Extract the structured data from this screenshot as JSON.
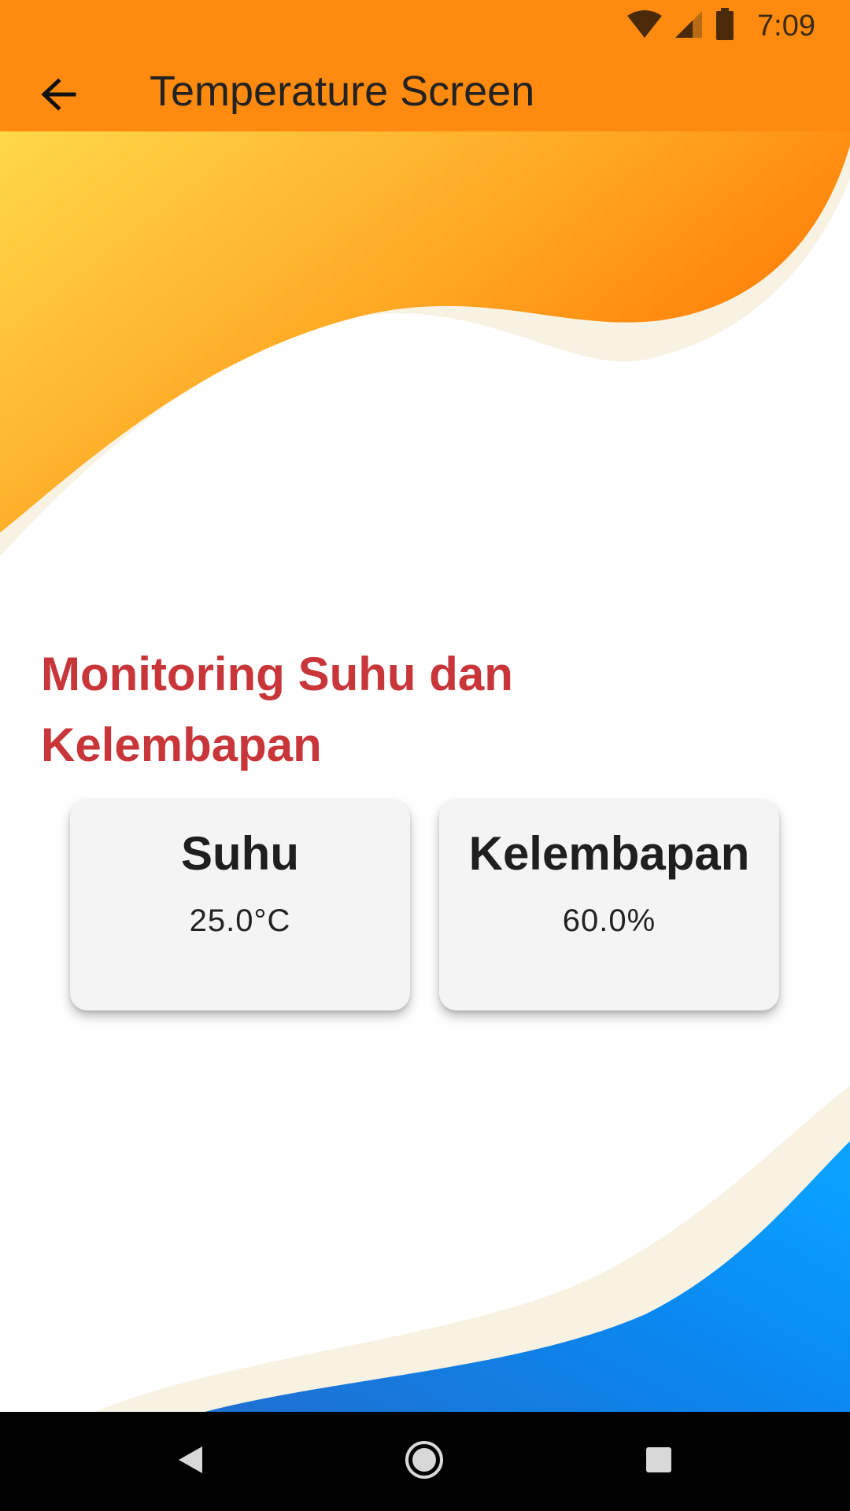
{
  "status_bar": {
    "time": "7:09",
    "icons": [
      "wifi-icon",
      "cell-signal-icon",
      "battery-icon"
    ]
  },
  "app_bar": {
    "title": "Temperature Screen",
    "back_icon": "arrow-left-icon"
  },
  "main": {
    "heading": "Monitoring Suhu dan Kelembapan",
    "cards": [
      {
        "title": "Suhu",
        "value": "25.0°C"
      },
      {
        "title": "Kelembapan",
        "value": "60.0%"
      }
    ]
  },
  "nav_bar": {
    "buttons": [
      "nav-back-icon",
      "nav-home-icon",
      "nav-recents-icon"
    ]
  },
  "colors": {
    "app_bar": "#ff8a10",
    "heading": "#c8363a",
    "card_background": "#f4f4f4",
    "top_wave_light": "#ffd84a",
    "top_wave_dark": "#ff7a00",
    "bottom_wave_light": "#1f7fe0",
    "bottom_wave_dark": "#0a9bff",
    "wave_edge": "#f7f2e2"
  }
}
